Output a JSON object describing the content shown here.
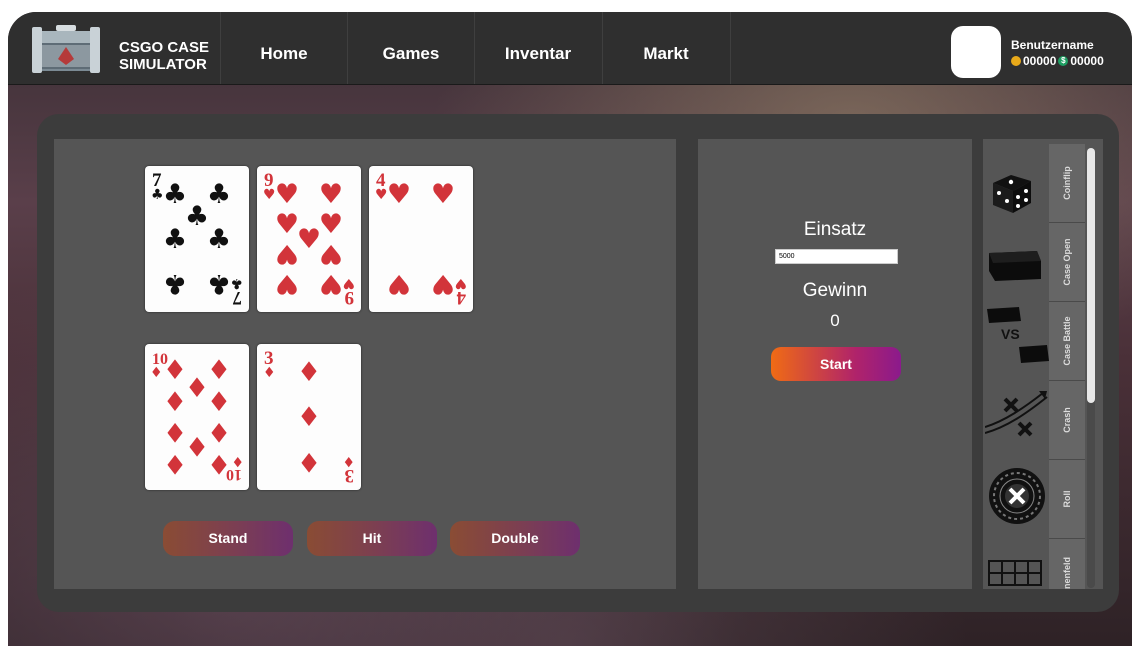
{
  "header": {
    "brand_line1": "CSGO CASE",
    "brand_line2": "SIMULATOR",
    "nav": [
      {
        "label": "Home"
      },
      {
        "label": "Games"
      },
      {
        "label": "Inventar"
      },
      {
        "label": "Markt"
      }
    ],
    "user": {
      "name": "Benutzername",
      "coins": "00000",
      "dollars": "00000",
      "dollar_symbol": "$"
    }
  },
  "blackjack": {
    "dealer_cards": [
      {
        "rank": "7",
        "suit": "clubs"
      },
      {
        "rank": "9",
        "suit": "hearts"
      },
      {
        "rank": "4",
        "suit": "hearts"
      }
    ],
    "player_cards": [
      {
        "rank": "10",
        "suit": "diamonds"
      },
      {
        "rank": "3",
        "suit": "diamonds"
      }
    ],
    "actions": {
      "stand": "Stand",
      "hit": "Hit",
      "double": "Double"
    }
  },
  "bet": {
    "label": "Einsatz",
    "input_value": "5000",
    "win_label": "Gewinn",
    "win_value": "0",
    "start_label": "Start"
  },
  "games": [
    {
      "label": "Coinflip",
      "icon": "dice-icon"
    },
    {
      "label": "Case Open",
      "icon": "case-icon"
    },
    {
      "label": "Case Battle",
      "icon": "case-battle-icon"
    },
    {
      "label": "Crash",
      "icon": "crash-icon"
    },
    {
      "label": "Roll",
      "icon": "roulette-icon"
    },
    {
      "label": "Minenfeld",
      "icon": "grid-icon"
    }
  ],
  "colors": {
    "hearts": "#d2343a",
    "diamonds": "#d2343a",
    "clubs": "#111111",
    "accent_start": "#f06b14",
    "accent_end": "#8b1a8c"
  }
}
